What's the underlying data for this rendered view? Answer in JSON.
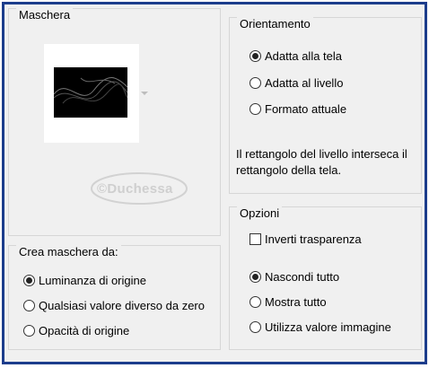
{
  "mask_group": {
    "title": "Maschera",
    "thumbnail_name": "mask-thumbnail",
    "watermark_text": "©Duchessa"
  },
  "source_group": {
    "title": "Crea maschera da:",
    "options": [
      {
        "label": "Luminanza di origine",
        "selected": true
      },
      {
        "label": "Qualsiasi valore diverso da zero",
        "selected": false
      },
      {
        "label": "Opacità di origine",
        "selected": false
      }
    ]
  },
  "orientation_group": {
    "title": "Orientamento",
    "options": [
      {
        "label": "Adatta alla tela",
        "selected": true
      },
      {
        "label": "Adatta al livello",
        "selected": false
      },
      {
        "label": "Formato attuale",
        "selected": false
      }
    ],
    "info": "Il rettangolo del livello interseca il rettangolo della tela."
  },
  "options_group": {
    "title": "Opzioni",
    "invert_label": "Inverti trasparenza",
    "invert_checked": false,
    "options": [
      {
        "label": "Nascondi tutto",
        "selected": true
      },
      {
        "label": "Mostra tutto",
        "selected": false
      },
      {
        "label": "Utilizza valore immagine",
        "selected": false
      }
    ]
  },
  "colors": {
    "frame_border": "#1c3d8c",
    "panel_bg": "#f0f0f0"
  }
}
